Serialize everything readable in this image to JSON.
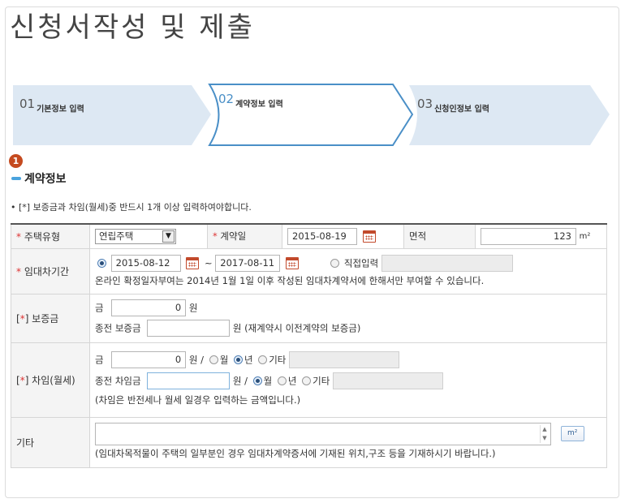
{
  "page": {
    "title": "신청서작성 및 제출"
  },
  "steps": [
    {
      "num": "01",
      "label": "기본정보 입력",
      "active": false
    },
    {
      "num": "02",
      "label": "계약정보 입력",
      "active": true
    },
    {
      "num": "03",
      "label": "신청인정보 입력",
      "active": false
    }
  ],
  "section": {
    "marker": "1",
    "title": "계약정보",
    "notice": "• [*] 보증금과 차임(월세)중 반드시 1개 이상 입력하여야합니다."
  },
  "colors": {
    "accent": "#4a8fc7",
    "marker": "#c54a1f",
    "required": "#dd3333",
    "step_fill": "#dde8f3"
  },
  "form": {
    "row1": {
      "housing_type_label": "주택유형",
      "housing_type_value": "연립주택",
      "contract_date_label": "계약일",
      "contract_date_value": "2015-08-19",
      "area_label": "면적",
      "area_value": "123",
      "area_unit": "m²"
    },
    "period": {
      "label": "임대차기간",
      "start": "2015-08-12",
      "tilde": "~",
      "end": "2017-08-11",
      "direct_input_label": "직접입력",
      "note": "온라인 확정일자부여는 2014년 1월 1일 이후 작성된 임대차계약서에 한해서만 부여할 수 있습니다."
    },
    "deposit": {
      "label_prefix": "[",
      "label_star": "*",
      "label_suffix": "] 보증금",
      "amount_label": "금",
      "amount_value": "0",
      "won": "원",
      "prev_label": "종전 보증금",
      "prev_note": "원 (재계약시 이전계약의 보증금)"
    },
    "rent": {
      "label_prefix": "[",
      "label_star": "*",
      "label_suffix": "] 차임(월세)",
      "amount_label": "금",
      "amount_value": "0",
      "won_slash": "원 /",
      "opt_month": "월",
      "opt_year": "년",
      "opt_other": "기타",
      "prev_label": "종전 차임금",
      "note": "(차임은 반전세나 월세 일경우 입력하는 금액입니다.)"
    },
    "etc": {
      "label": "기타",
      "unit_button": "m²",
      "note": "(임대차목적물이 주택의 일부분인 경우 임대차계약증서에 기재된 위치,구조 등을 기재하시기 바랍니다.)"
    }
  }
}
